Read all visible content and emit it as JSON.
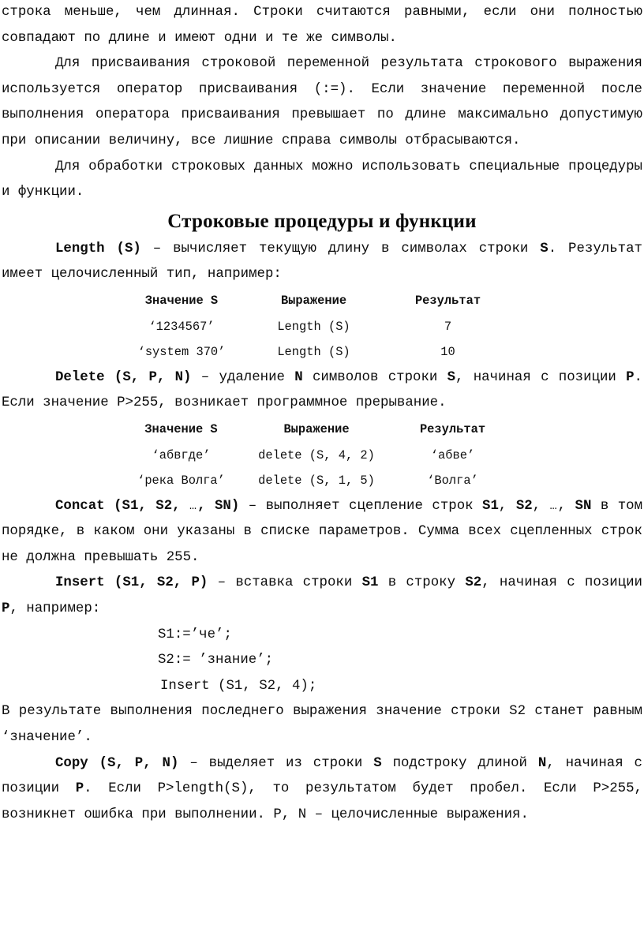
{
  "document": {
    "paragraphs": {
      "p1_line_a": "строка меньше, чем длинная. Строки считаются равными, если",
      "p1_line_b": "они полностью совпадают по длине и имеют одни и те же символы.",
      "p2": "Для присваивания строковой переменной результата строкового выражения используется оператор присваивания (:=). Если значение переменной после выполнения оператора присваивания превышает по длине максимально допустимую при описании величину, все лишние справа символы отбрасываются.",
      "p3": "Для обработки строковых данных можно использовать специальные процедуры и функции."
    },
    "heading": "Строковые процедуры и функции",
    "length_section": {
      "signature": "Length (S)",
      "dash": " – ",
      "text_part1": "вычисляет текущую длину в символах строки ",
      "bold_s": "S",
      "text_part2": ". Результат имеет целочисленный тип, например:"
    },
    "table_length": {
      "headers": [
        "Значение S",
        "Выражение",
        "Результат"
      ],
      "rows": [
        [
          "‘1234567’",
          "Length (S)",
          "7"
        ],
        [
          "‘system 370’",
          "Length (S)",
          "10"
        ]
      ]
    },
    "delete_section": {
      "signature": "Delete (S, P, N)",
      "dash": " – ",
      "text_part1": "удаление ",
      "bold_n": "N",
      "text_part2": " символов строки ",
      "bold_s": "S",
      "text_part3": ", начиная с позиции ",
      "bold_p": "P",
      "text_part4": ". Если значение P>255, возникает программное прерывание."
    },
    "table_delete": {
      "headers": [
        "Значение S",
        "Выражение",
        "Результат"
      ],
      "rows": [
        [
          "‘абвгде’",
          "delete (S, 4, 2)",
          "‘абве’"
        ],
        [
          "‘река Волга’",
          "delete (S, 1, 5)",
          "‘Волга’"
        ]
      ]
    },
    "concat_section": {
      "sig_part1": "Concat (S1, S2, ",
      "sig_ellipsis": "…",
      "sig_part2": ", SN)",
      "dash": " – ",
      "text_part1": "выполняет сцепление строк ",
      "bold_s1": "S1",
      "text_comma1": ", ",
      "bold_s2": "S2",
      "text_comma2": ", ",
      "text_ellipsis2": "…",
      "text_comma3": ", ",
      "bold_sn": "SN",
      "text_part2": " в том порядке, в каком они указаны в списке параметров. Сумма всех сцепленных строк не должна превышать 255."
    },
    "insert_section": {
      "signature": "Insert (S1, S2, P)",
      "dash": " – ",
      "text_part1": "вставка строки ",
      "bold_s1": "S1",
      "text_part2": " в строку ",
      "bold_s2": "S2",
      "text_part3": ", начиная с позиции ",
      "bold_p": "P",
      "text_part4": ", например:"
    },
    "code_lines": [
      "S1:=’че’;",
      "S2:= ’знание’;",
      "Insert (S1, S2, 4);"
    ],
    "after_code": {
      "text_part1": "В результате выполнения последнего выражения значение строки S2 станет равным ‘значение’."
    },
    "copy_section": {
      "signature": "Copy (S, P, N)",
      "dash": " – ",
      "text_part1": "выделяет из строки ",
      "bold_s": "S",
      "text_part2": " подстроку длиной ",
      "bold_n": "N",
      "text_part3": ", начиная с позиции ",
      "bold_p": "P",
      "text_part4": ". Если P>length(S), то результатом будет пробел. Если P>255, возникнет ошибка при выполнении. P, N – целочисленные выражения."
    }
  }
}
